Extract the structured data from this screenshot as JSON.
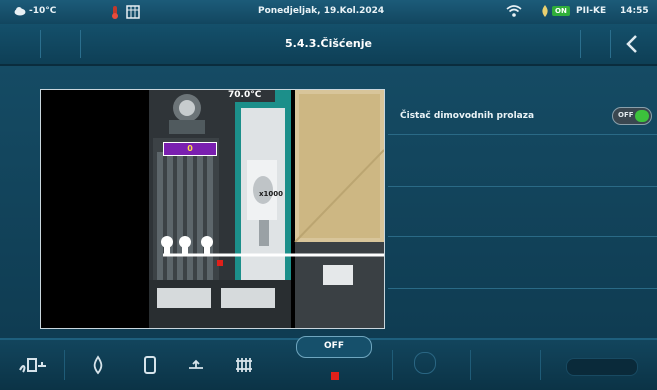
{
  "status_bar": {
    "outdoor_temp": "-10°C",
    "date": "Ponedjeljak, 19.Kol.2024",
    "status_badge": "ON",
    "mode": "PII-KE",
    "time": "14:55"
  },
  "header": {
    "title": "5.4.3.Čišćenje",
    "back_icon": "chevron-left-icon"
  },
  "diagram": {
    "temperature": "70.0°C",
    "counter": "0",
    "fan_label": "x1000"
  },
  "settings": [
    {
      "label": "Čistač dimovodnih prolaza",
      "toggle_state": "OFF",
      "toggle_on": true
    }
  ],
  "bottom_bar": {
    "off_label": "OFF",
    "icons": [
      "boiler-burner-icon",
      "flame-icon",
      "tank-icon",
      "pump-icon",
      "radiator-icon"
    ]
  },
  "colors": {
    "background": "#0f3b52",
    "accent_green": "#3cc23c",
    "stop_red": "#e0201a",
    "counter_purple": "#7a1fb0"
  }
}
